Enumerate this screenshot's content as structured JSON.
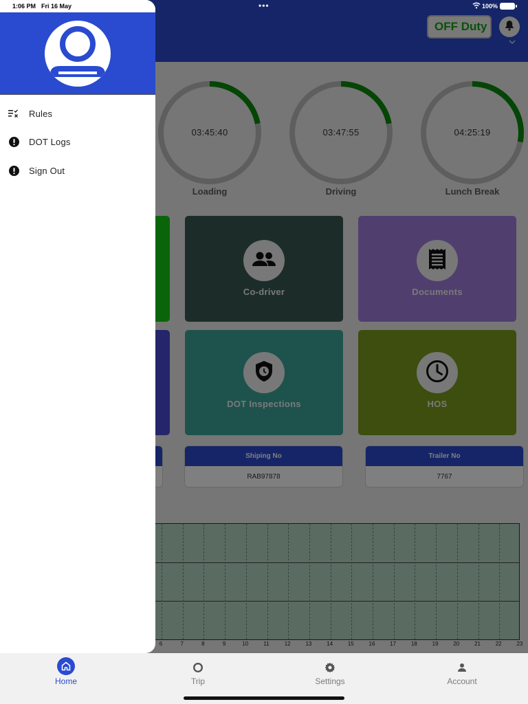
{
  "status_bar": {
    "time": "1:06 PM",
    "date": "Fri 16 May",
    "battery": "100%",
    "dots": "•••"
  },
  "header": {
    "duty_button": "OFF Duty",
    "bell_icon": "bell-icon",
    "chevron_icon": "chevron-down-icon"
  },
  "gauges": [
    {
      "time": "03:45:40",
      "label": "Loading",
      "progress": 0.22
    },
    {
      "time": "03:47:55",
      "label": "Driving",
      "progress": 0.22
    },
    {
      "time": "04:25:19",
      "label": "Lunch Break",
      "progress": 0.28
    }
  ],
  "tiles": [
    {
      "label": "Co-driver",
      "icon": "people-icon",
      "color": "#385a52"
    },
    {
      "label": "Documents",
      "icon": "receipt-icon",
      "color": "#a07fdc"
    },
    {
      "label": "DOT Inspections",
      "icon": "shield-clock-icon",
      "color": "#3da79b"
    },
    {
      "label": "HOS",
      "icon": "clock-icon",
      "color": "#7a9d1e"
    }
  ],
  "info_cards": [
    {
      "title": "Shiping No",
      "value": "RAB97878"
    },
    {
      "title": "Trailer No",
      "value": "7767"
    }
  ],
  "graph": {
    "hours": [
      "6",
      "7",
      "8",
      "9",
      "10",
      "11",
      "12",
      "13",
      "14",
      "15",
      "16",
      "17",
      "18",
      "19",
      "20",
      "21",
      "22",
      "23"
    ]
  },
  "drawer": {
    "items": [
      {
        "label": "Rules",
        "icon": "rules-checklist-icon"
      },
      {
        "label": "DOT Logs",
        "icon": "alert-circle-icon"
      },
      {
        "label": "Sign Out",
        "icon": "alert-circle-icon"
      }
    ]
  },
  "bottom_nav": {
    "items": [
      {
        "label": "Home",
        "icon": "home-icon",
        "active": true
      },
      {
        "label": "Trip",
        "icon": "trip-circle-icon",
        "active": false
      },
      {
        "label": "Settings",
        "icon": "gear-icon",
        "active": false
      },
      {
        "label": "Account",
        "icon": "person-icon",
        "active": false
      }
    ]
  },
  "colors": {
    "brand": "#2a4bd0",
    "duty_green": "#14a314",
    "gauge_progress": "#0a8a0a",
    "gauge_track": "#bdbdbd"
  }
}
